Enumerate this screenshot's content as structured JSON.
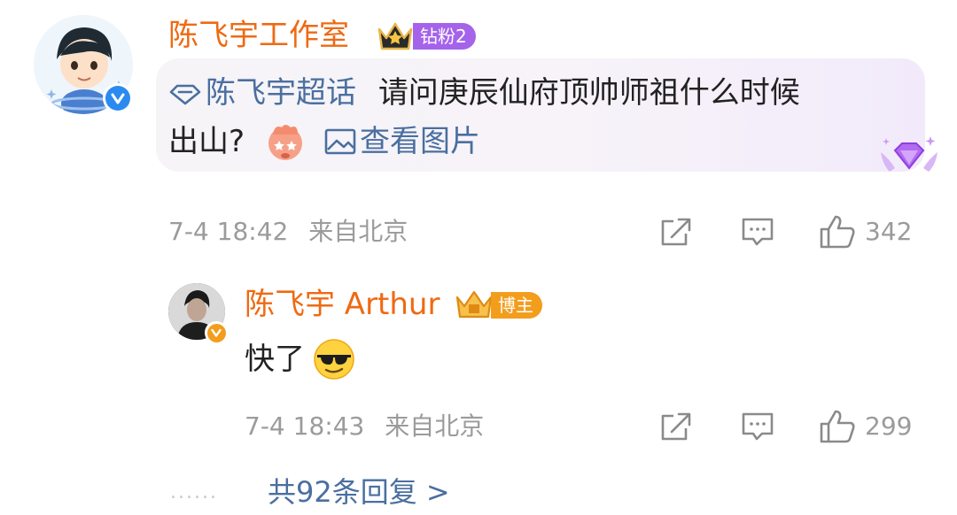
{
  "comment": {
    "username": "陈飞宇工作室",
    "fan_badge": "钻粉2",
    "topic": "陈飞宇超话",
    "text_line1": "请问庚辰仙府顶帅师祖什么时候",
    "text_line2": "出山?",
    "view_image": "查看图片",
    "time": "7-4 18:42",
    "location": "来自北京",
    "likes": "342",
    "icons": {
      "share": "share-icon",
      "comment": "comment-icon",
      "like": "thumbs-up-icon",
      "topic": "diamond-topic-icon",
      "image": "image-icon"
    }
  },
  "reply": {
    "username": "陈飞宇 Arthur",
    "author_badge": "博主",
    "text": "快了",
    "time": "7-4 18:43",
    "location": "来自北京",
    "likes": "299"
  },
  "footer": {
    "dots": "......",
    "more_replies": "共92条回复 >"
  },
  "colors": {
    "username": "#ee6a13",
    "link": "#4a6fa0",
    "meta": "#9b9b9b",
    "fan_badge": "#a563ea",
    "author_badge": "#f39d1d",
    "verified_blue": "#2b8af0"
  }
}
